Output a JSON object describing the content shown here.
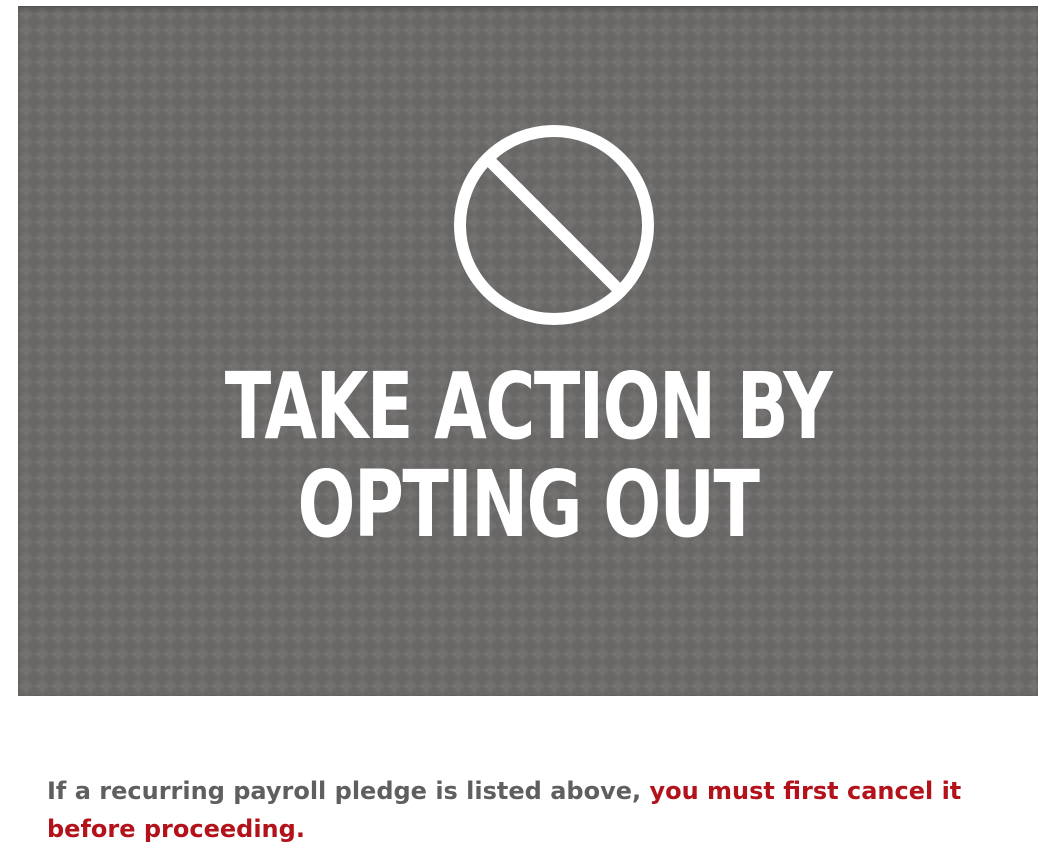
{
  "hero": {
    "icon": "no-entry-icon",
    "title_line1": "TAKE ACTION BY",
    "title_line2": "OPTING OUT",
    "background_color": "#6f6d6c",
    "text_color": "#ffffff"
  },
  "notice": {
    "text_plain": "If a recurring payroll pledge is listed above, ",
    "text_warning": "you must first cancel it before proceeding.",
    "plain_color": "#5f5f5f",
    "warning_color": "#b3121b"
  }
}
